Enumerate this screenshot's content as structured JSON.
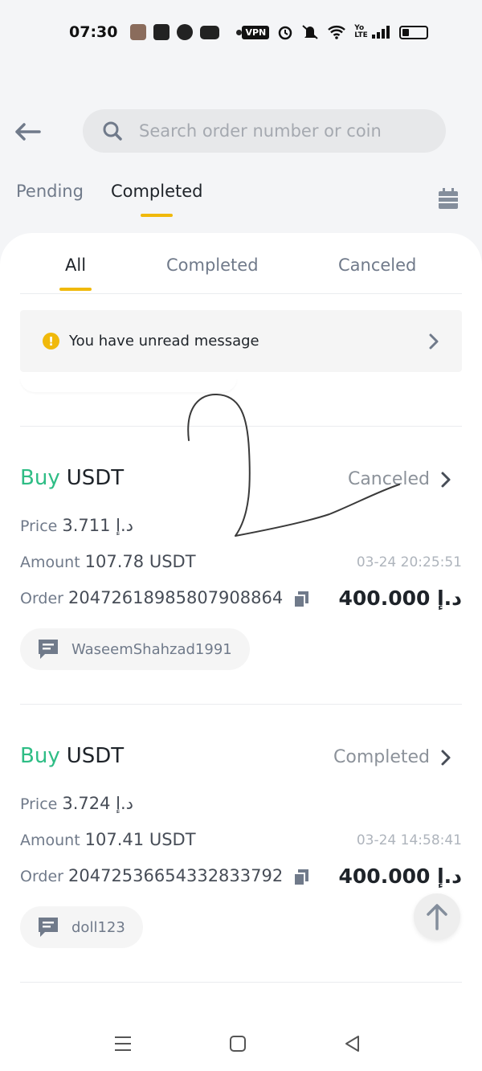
{
  "status_bar": {
    "time": "07:30",
    "vpn_label": "VPN",
    "network_label": "Yo LTE"
  },
  "search": {
    "placeholder": "Search order number or coin"
  },
  "top_tabs": [
    {
      "label": "Pending",
      "active": false
    },
    {
      "label": "Completed",
      "active": true
    }
  ],
  "sub_tabs": [
    {
      "label": "All",
      "active": true
    },
    {
      "label": "Completed",
      "active": false
    },
    {
      "label": "Canceled",
      "active": false
    }
  ],
  "notice": {
    "message": "You have unread message"
  },
  "labels": {
    "price": "Price",
    "amount": "Amount",
    "order": "Order"
  },
  "orders": [
    {
      "side": "Buy",
      "coin": "USDT",
      "status": "Canceled",
      "price": "3.711 د.إ",
      "amount": "107.78 USDT",
      "time": "03-24 20:25:51",
      "order_no": "20472618985807908864",
      "total": "400.000 د.إ",
      "counterparty": "WaseemShahzad1991"
    },
    {
      "side": "Buy",
      "coin": "USDT",
      "status": "Completed",
      "price": "3.724 د.إ",
      "amount": "107.41 USDT",
      "time": "03-24 14:58:41",
      "order_no": "20472536654332833792",
      "total": "400.000 د.إ",
      "counterparty": "doll123"
    }
  ],
  "colors": {
    "accent": "#f0b90b",
    "buy": "#2ebd85",
    "text_primary": "#1e2329",
    "text_secondary": "#707a8a"
  },
  "icons": [
    "back-arrow-icon",
    "search-icon",
    "calendar-icon",
    "warning-icon",
    "chevron-right-icon",
    "copy-icon",
    "chat-icon",
    "arrow-up-icon"
  ]
}
